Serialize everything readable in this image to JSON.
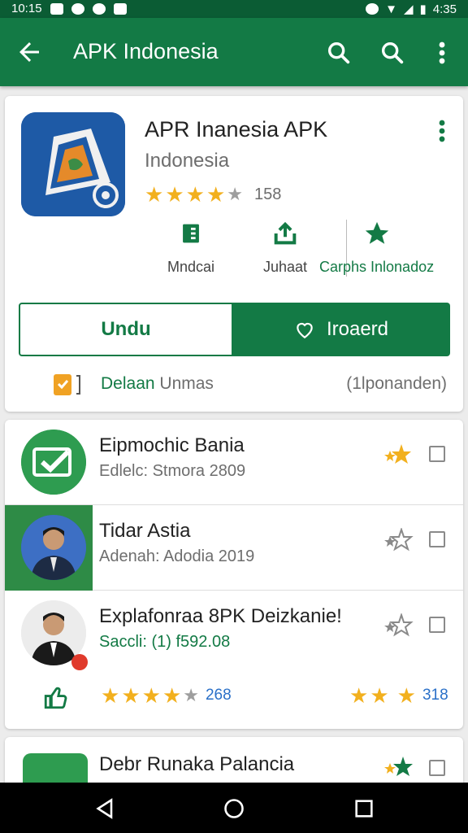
{
  "status_bar": {
    "time_left": "10:15",
    "time_right": "4:35"
  },
  "app_bar": {
    "title": "APK Indonesia"
  },
  "app": {
    "name": "APR Inanesia APK",
    "developer": "Indonesia",
    "rating_count": "158",
    "actions": [
      {
        "label": "Mndcai",
        "icon": "download-icon"
      },
      {
        "label": "Juhaat",
        "icon": "share-icon"
      },
      {
        "label": "Carphs Inlonadoz",
        "icon": "star-icon"
      }
    ],
    "primary_button": "Undu",
    "secondary_button": "Iroaerd",
    "footer_left": "Delaan",
    "footer_left_suffix": "Unmas",
    "footer_right": "(1lponanden)"
  },
  "list": [
    {
      "title": "Eipmochic Bania",
      "subtitle": "Edlelc: Stmora 2809"
    },
    {
      "title": "Tidar Astia",
      "subtitle": "Adenah: Adodia 2019"
    },
    {
      "title": "Explafonraa 8PK Deizkanie!",
      "subtitle": "Saccli: (1) f592.08"
    }
  ],
  "ratings_row": {
    "left_count": "268",
    "right_count": "318"
  },
  "partial_item": {
    "title": "Debr Runaka Palancia"
  },
  "colors": {
    "primary": "#137a45",
    "status_bar": "#0b5c34",
    "star": "#f2b01e",
    "accent_blue": "#2a70c8"
  }
}
